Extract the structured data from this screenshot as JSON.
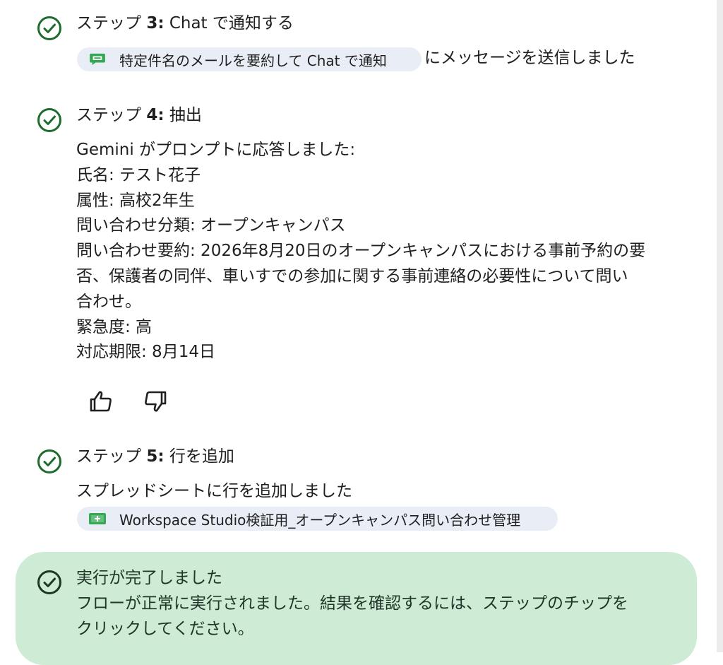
{
  "steps": [
    {
      "title_prefix": "ステップ ",
      "number": "3:",
      "title_suffix": " Chat で通知する",
      "chip_label": "特定件名のメールを要約して Chat で通知",
      "after_chip": "にメッセージを送信しました",
      "chip_icon": "google-chat-icon"
    },
    {
      "title_prefix": "ステップ ",
      "number": "4:",
      "title_suffix": " 抽出",
      "lines": [
        "Gemini がプロンプトに応答しました:",
        "氏名: テスト花子",
        "属性: 高校2年生",
        "問い合わせ分類: オープンキャンパス",
        "問い合わせ要約: 2026年8月20日のオープンキャンパスにおける事前予約の要",
        "否、保護者の同伴、車いすでの参加に関する事前連絡の必要性について問い",
        "合わせ。",
        "緊急度: 高",
        "対応期限: 8月14日"
      ]
    },
    {
      "title_prefix": "ステップ ",
      "number": "5:",
      "title_suffix": " 行を追加",
      "text": "スプレッドシートに行を追加しました",
      "chip_label": "Workspace Studio検証用_オープンキャンパス問い合わせ管理",
      "chip_icon": "google-sheets-icon"
    }
  ],
  "feedback": {
    "like_icon": "thumbs-up-icon",
    "dislike_icon": "thumbs-down-icon"
  },
  "completion": {
    "title": "実行が完了しました",
    "lines": [
      "フローが正常に実行されました。結果を確認するには、ステップのチップを",
      "クリックしてください。"
    ]
  },
  "colors": {
    "check": "#1e6b2e",
    "chip_bg": "#e9eef6",
    "complete_bg": "#cdebd5"
  }
}
